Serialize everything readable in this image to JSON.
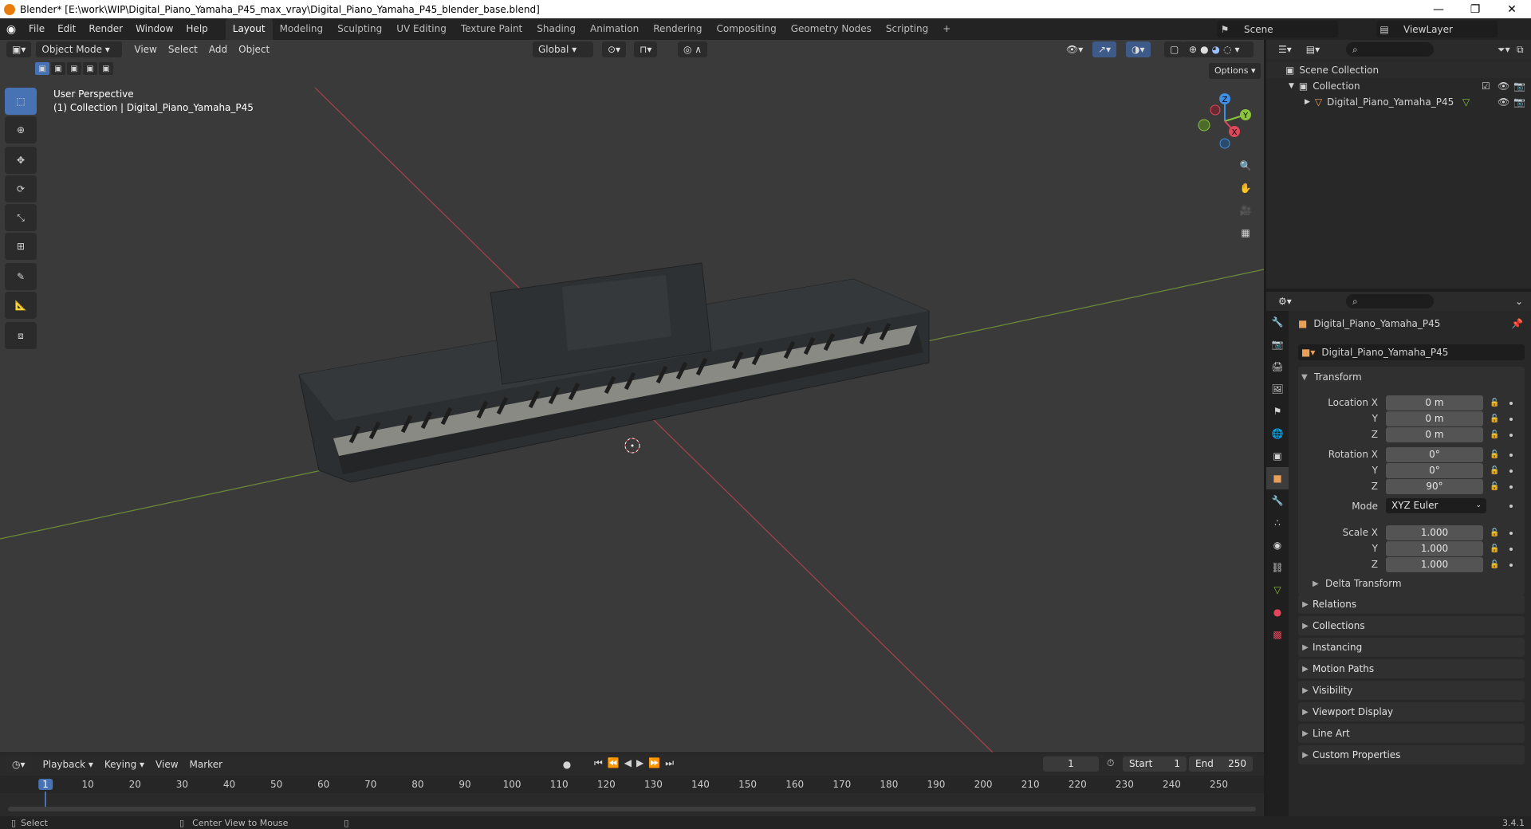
{
  "window": {
    "title": "Blender* [E:\\work\\WIP\\Digital_Piano_Yamaha_P45_max_vray\\Digital_Piano_Yamaha_P45_blender_base.blend]",
    "minimize": "—",
    "maximize": "❐",
    "close": "✕"
  },
  "menu": [
    "File",
    "Edit",
    "Render",
    "Window",
    "Help"
  ],
  "workspaces": [
    "Layout",
    "Modeling",
    "Sculpting",
    "UV Editing",
    "Texture Paint",
    "Shading",
    "Animation",
    "Rendering",
    "Compositing",
    "Geometry Nodes",
    "Scripting"
  ],
  "workspace_add": "+",
  "scene": {
    "label": "Scene",
    "view_layer": "ViewLayer"
  },
  "viewport": {
    "mode": "Object Mode",
    "menus": [
      "View",
      "Select",
      "Add",
      "Object"
    ],
    "orientation": "Global",
    "options_label": "Options",
    "overlay_line1": "User Perspective",
    "overlay_line2": "(1) Collection | Digital_Piano_Yamaha_P45",
    "gizmo": {
      "x": "X",
      "y": "Y",
      "z": "Z"
    }
  },
  "outliner": {
    "scene_collection": "Scene Collection",
    "collection": "Collection",
    "object": "Digital_Piano_Yamaha_P45"
  },
  "properties": {
    "object_name": "Digital_Piano_Yamaha_P45",
    "data_name": "Digital_Piano_Yamaha_P45",
    "transform_title": "Transform",
    "location_label": "Location X",
    "rotation_label": "Rotation X",
    "scale_label": "Scale X",
    "axis_y": "Y",
    "axis_z": "Z",
    "location": [
      "0 m",
      "0 m",
      "0 m"
    ],
    "rotation": [
      "0°",
      "0°",
      "90°"
    ],
    "mode_label": "Mode",
    "mode_value": "XYZ Euler",
    "scale": [
      "1.000",
      "1.000",
      "1.000"
    ],
    "delta_transform": "Delta Transform",
    "panels": [
      "Relations",
      "Collections",
      "Instancing",
      "Motion Paths",
      "Visibility",
      "Viewport Display",
      "Line Art",
      "Custom Properties"
    ]
  },
  "timeline": {
    "menus": [
      "Playback",
      "Keying",
      "View",
      "Marker"
    ],
    "current_frame": "1",
    "start_label": "Start",
    "start": "1",
    "end_label": "End",
    "end": "250",
    "ruler": [
      "1",
      "10",
      "20",
      "30",
      "40",
      "50",
      "60",
      "70",
      "80",
      "90",
      "100",
      "110",
      "120",
      "130",
      "140",
      "150",
      "160",
      "170",
      "180",
      "190",
      "200",
      "210",
      "220",
      "230",
      "240",
      "250"
    ]
  },
  "status": {
    "left": "Select",
    "middle": "Center View to Mouse",
    "version": "3.4.1"
  },
  "colors": {
    "accent": "#4772b3",
    "x_axis": "#e0475b",
    "y_axis": "#8bc43a",
    "z_axis": "#3f8fe8",
    "orange": "#e87d0d"
  }
}
